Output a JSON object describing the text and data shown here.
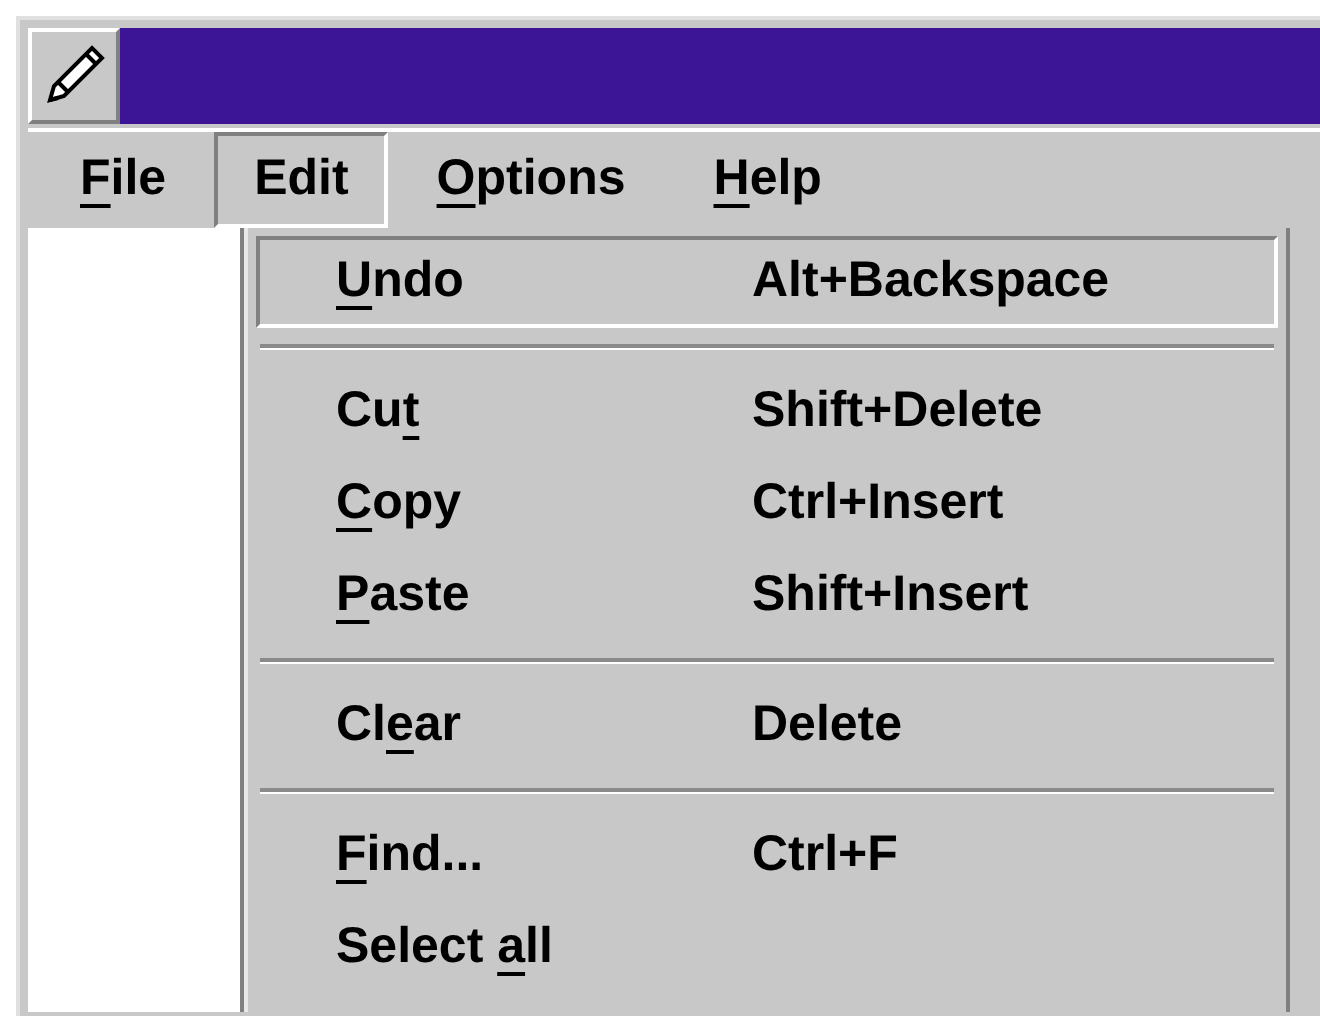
{
  "menu_bar": [
    {
      "label": [
        {
          "text": "F",
          "underlined": true
        },
        {
          "text": "ile",
          "underlined": false
        }
      ],
      "selected": false
    },
    {
      "label": [
        {
          "text": "Edit",
          "underlined": false
        }
      ],
      "selected": true
    },
    {
      "label": [
        {
          "text": "O",
          "underlined": true
        },
        {
          "text": "ptions",
          "underlined": false
        }
      ],
      "selected": false
    },
    {
      "label": [
        {
          "text": "H",
          "underlined": true
        },
        {
          "text": "elp",
          "underlined": false
        }
      ],
      "selected": false
    }
  ],
  "edit_menu": [
    {
      "kind": "item",
      "label": [
        {
          "text": "U",
          "underlined": true
        },
        {
          "text": "ndo",
          "underlined": false
        }
      ],
      "shortcut": "Alt+Backspace",
      "selected": true
    },
    {
      "kind": "separator"
    },
    {
      "kind": "item",
      "label": [
        {
          "text": "Cu",
          "underlined": false
        },
        {
          "text": "t",
          "underlined": true
        }
      ],
      "shortcut": "Shift+Delete",
      "selected": false
    },
    {
      "kind": "item",
      "label": [
        {
          "text": "C",
          "underlined": true
        },
        {
          "text": "opy",
          "underlined": false
        }
      ],
      "shortcut": "Ctrl+Insert",
      "selected": false
    },
    {
      "kind": "item",
      "label": [
        {
          "text": "P",
          "underlined": true
        },
        {
          "text": "aste",
          "underlined": false
        }
      ],
      "shortcut": "Shift+Insert",
      "selected": false
    },
    {
      "kind": "separator"
    },
    {
      "kind": "item",
      "label": [
        {
          "text": "Cl",
          "underlined": false
        },
        {
          "text": "e",
          "underlined": true
        },
        {
          "text": "ar",
          "underlined": false
        }
      ],
      "shortcut": "Delete",
      "selected": false
    },
    {
      "kind": "separator"
    },
    {
      "kind": "item",
      "label": [
        {
          "text": "F",
          "underlined": true
        },
        {
          "text": "ind...",
          "underlined": false
        }
      ],
      "shortcut": "Ctrl+F",
      "selected": false
    },
    {
      "kind": "item",
      "label": [
        {
          "text": "Select ",
          "underlined": false
        },
        {
          "text": "a",
          "underlined": true
        },
        {
          "text": "ll",
          "underlined": false
        }
      ],
      "selected": false
    }
  ]
}
